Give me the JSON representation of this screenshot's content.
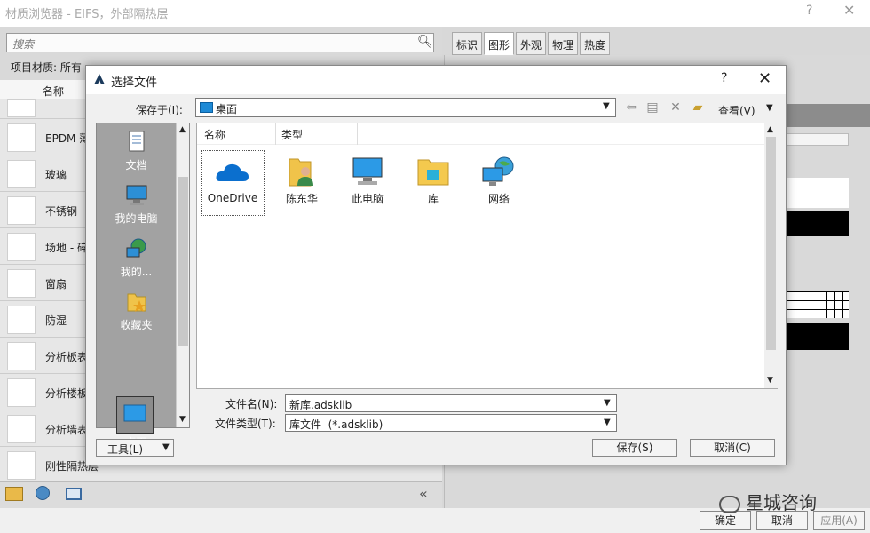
{
  "background_window": {
    "title": "材质浏览器 - EIFS，外部隔热层",
    "help": "?",
    "close": "✕",
    "search_placeholder": "搜索",
    "project_materials": "项目材质: 所有",
    "column_name": "名称",
    "materials": [
      "EPDM 薄",
      "玻璃",
      "不锈钢",
      "场地 - 碎",
      "窗扇",
      "防湿",
      "分析板表",
      "分析楼板",
      "分析墙表",
      "刚性隔热层"
    ],
    "tabs": [
      "标识",
      "图形",
      "外观",
      "物理",
      "热度"
    ],
    "footer_buttons": {
      "ok": "确定",
      "cancel": "取消",
      "apply": "应用(A)"
    }
  },
  "watermark": "星城咨询",
  "dialog": {
    "title": "选择文件",
    "help": "?",
    "close": "✕",
    "save_in_label": "保存于(I):",
    "save_in_value": "桌面",
    "view_label": "查看(V)",
    "places": [
      "文档",
      "我的电脑",
      "我的...",
      "收藏夹",
      "桌面"
    ],
    "columns": {
      "name": "名称",
      "type": "类型"
    },
    "files": [
      "OneDrive",
      "陈东华",
      "此电脑",
      "库",
      "网络"
    ],
    "filename_label": "文件名(N):",
    "filename_value": "新库.adsklib",
    "filetype_label": "文件类型(T):",
    "filetype_value": "库文件  (*.adsklib)",
    "tools_label": "工具(L)",
    "save_label": "保存(S)",
    "cancel_label": "取消(C)"
  }
}
